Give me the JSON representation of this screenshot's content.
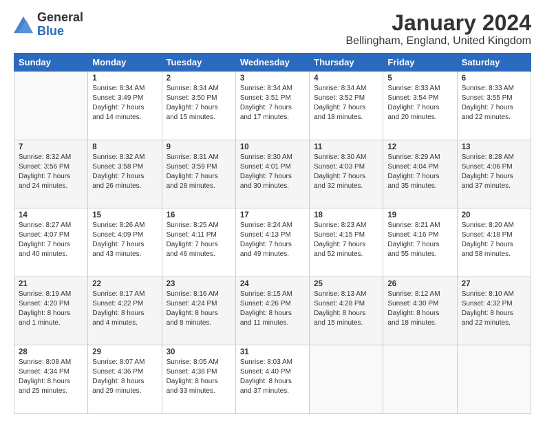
{
  "header": {
    "logo": {
      "general": "General",
      "blue": "Blue"
    },
    "title": "January 2024",
    "location": "Bellingham, England, United Kingdom"
  },
  "days_header": [
    "Sunday",
    "Monday",
    "Tuesday",
    "Wednesday",
    "Thursday",
    "Friday",
    "Saturday"
  ],
  "weeks": [
    [
      {
        "day": "",
        "sunrise": "",
        "sunset": "",
        "daylight": ""
      },
      {
        "day": "1",
        "sunrise": "Sunrise: 8:34 AM",
        "sunset": "Sunset: 3:49 PM",
        "daylight": "Daylight: 7 hours and 14 minutes."
      },
      {
        "day": "2",
        "sunrise": "Sunrise: 8:34 AM",
        "sunset": "Sunset: 3:50 PM",
        "daylight": "Daylight: 7 hours and 15 minutes."
      },
      {
        "day": "3",
        "sunrise": "Sunrise: 8:34 AM",
        "sunset": "Sunset: 3:51 PM",
        "daylight": "Daylight: 7 hours and 17 minutes."
      },
      {
        "day": "4",
        "sunrise": "Sunrise: 8:34 AM",
        "sunset": "Sunset: 3:52 PM",
        "daylight": "Daylight: 7 hours and 18 minutes."
      },
      {
        "day": "5",
        "sunrise": "Sunrise: 8:33 AM",
        "sunset": "Sunset: 3:54 PM",
        "daylight": "Daylight: 7 hours and 20 minutes."
      },
      {
        "day": "6",
        "sunrise": "Sunrise: 8:33 AM",
        "sunset": "Sunset: 3:55 PM",
        "daylight": "Daylight: 7 hours and 22 minutes."
      }
    ],
    [
      {
        "day": "7",
        "sunrise": "Sunrise: 8:32 AM",
        "sunset": "Sunset: 3:56 PM",
        "daylight": "Daylight: 7 hours and 24 minutes."
      },
      {
        "day": "8",
        "sunrise": "Sunrise: 8:32 AM",
        "sunset": "Sunset: 3:58 PM",
        "daylight": "Daylight: 7 hours and 26 minutes."
      },
      {
        "day": "9",
        "sunrise": "Sunrise: 8:31 AM",
        "sunset": "Sunset: 3:59 PM",
        "daylight": "Daylight: 7 hours and 28 minutes."
      },
      {
        "day": "10",
        "sunrise": "Sunrise: 8:30 AM",
        "sunset": "Sunset: 4:01 PM",
        "daylight": "Daylight: 7 hours and 30 minutes."
      },
      {
        "day": "11",
        "sunrise": "Sunrise: 8:30 AM",
        "sunset": "Sunset: 4:03 PM",
        "daylight": "Daylight: 7 hours and 32 minutes."
      },
      {
        "day": "12",
        "sunrise": "Sunrise: 8:29 AM",
        "sunset": "Sunset: 4:04 PM",
        "daylight": "Daylight: 7 hours and 35 minutes."
      },
      {
        "day": "13",
        "sunrise": "Sunrise: 8:28 AM",
        "sunset": "Sunset: 4:06 PM",
        "daylight": "Daylight: 7 hours and 37 minutes."
      }
    ],
    [
      {
        "day": "14",
        "sunrise": "Sunrise: 8:27 AM",
        "sunset": "Sunset: 4:07 PM",
        "daylight": "Daylight: 7 hours and 40 minutes."
      },
      {
        "day": "15",
        "sunrise": "Sunrise: 8:26 AM",
        "sunset": "Sunset: 4:09 PM",
        "daylight": "Daylight: 7 hours and 43 minutes."
      },
      {
        "day": "16",
        "sunrise": "Sunrise: 8:25 AM",
        "sunset": "Sunset: 4:11 PM",
        "daylight": "Daylight: 7 hours and 46 minutes."
      },
      {
        "day": "17",
        "sunrise": "Sunrise: 8:24 AM",
        "sunset": "Sunset: 4:13 PM",
        "daylight": "Daylight: 7 hours and 49 minutes."
      },
      {
        "day": "18",
        "sunrise": "Sunrise: 8:23 AM",
        "sunset": "Sunset: 4:15 PM",
        "daylight": "Daylight: 7 hours and 52 minutes."
      },
      {
        "day": "19",
        "sunrise": "Sunrise: 8:21 AM",
        "sunset": "Sunset: 4:16 PM",
        "daylight": "Daylight: 7 hours and 55 minutes."
      },
      {
        "day": "20",
        "sunrise": "Sunrise: 8:20 AM",
        "sunset": "Sunset: 4:18 PM",
        "daylight": "Daylight: 7 hours and 58 minutes."
      }
    ],
    [
      {
        "day": "21",
        "sunrise": "Sunrise: 8:19 AM",
        "sunset": "Sunset: 4:20 PM",
        "daylight": "Daylight: 8 hours and 1 minute."
      },
      {
        "day": "22",
        "sunrise": "Sunrise: 8:17 AM",
        "sunset": "Sunset: 4:22 PM",
        "daylight": "Daylight: 8 hours and 4 minutes."
      },
      {
        "day": "23",
        "sunrise": "Sunrise: 8:16 AM",
        "sunset": "Sunset: 4:24 PM",
        "daylight": "Daylight: 8 hours and 8 minutes."
      },
      {
        "day": "24",
        "sunrise": "Sunrise: 8:15 AM",
        "sunset": "Sunset: 4:26 PM",
        "daylight": "Daylight: 8 hours and 11 minutes."
      },
      {
        "day": "25",
        "sunrise": "Sunrise: 8:13 AM",
        "sunset": "Sunset: 4:28 PM",
        "daylight": "Daylight: 8 hours and 15 minutes."
      },
      {
        "day": "26",
        "sunrise": "Sunrise: 8:12 AM",
        "sunset": "Sunset: 4:30 PM",
        "daylight": "Daylight: 8 hours and 18 minutes."
      },
      {
        "day": "27",
        "sunrise": "Sunrise: 8:10 AM",
        "sunset": "Sunset: 4:32 PM",
        "daylight": "Daylight: 8 hours and 22 minutes."
      }
    ],
    [
      {
        "day": "28",
        "sunrise": "Sunrise: 8:08 AM",
        "sunset": "Sunset: 4:34 PM",
        "daylight": "Daylight: 8 hours and 25 minutes."
      },
      {
        "day": "29",
        "sunrise": "Sunrise: 8:07 AM",
        "sunset": "Sunset: 4:36 PM",
        "daylight": "Daylight: 8 hours and 29 minutes."
      },
      {
        "day": "30",
        "sunrise": "Sunrise: 8:05 AM",
        "sunset": "Sunset: 4:38 PM",
        "daylight": "Daylight: 8 hours and 33 minutes."
      },
      {
        "day": "31",
        "sunrise": "Sunrise: 8:03 AM",
        "sunset": "Sunset: 4:40 PM",
        "daylight": "Daylight: 8 hours and 37 minutes."
      },
      {
        "day": "",
        "sunrise": "",
        "sunset": "",
        "daylight": ""
      },
      {
        "day": "",
        "sunrise": "",
        "sunset": "",
        "daylight": ""
      },
      {
        "day": "",
        "sunrise": "",
        "sunset": "",
        "daylight": ""
      }
    ]
  ]
}
